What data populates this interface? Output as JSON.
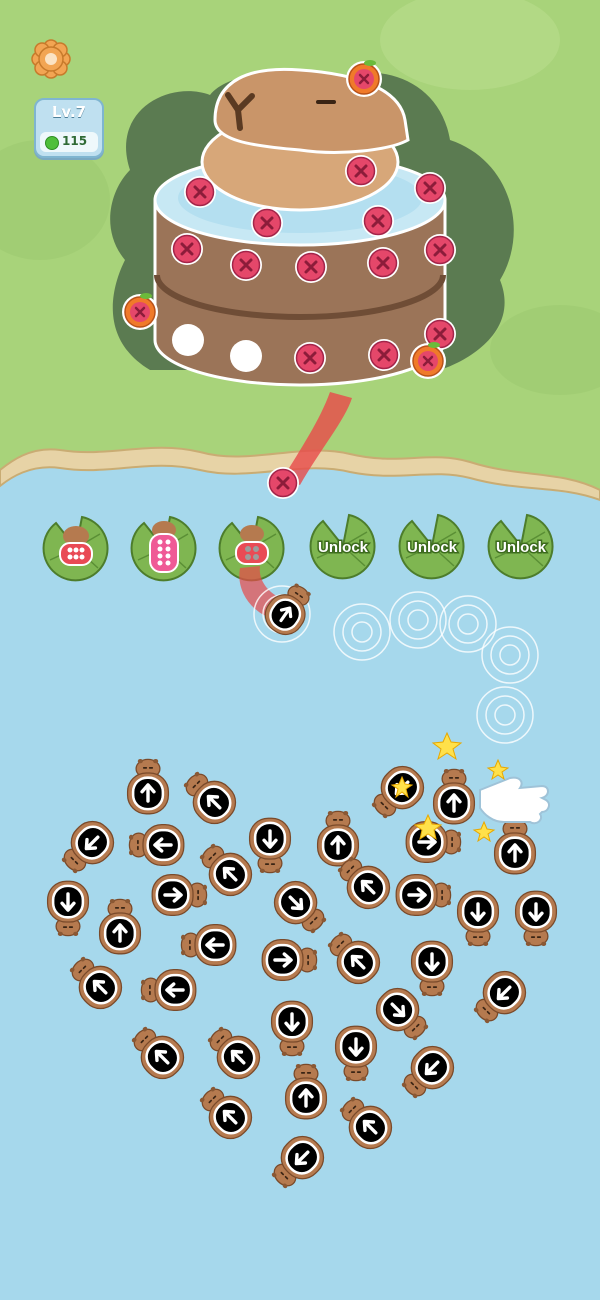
{
  "hud": {
    "settings_icon": "gear-icon",
    "level_label": "Lv.7",
    "coin_icon": "green-coin-icon",
    "coins": "115"
  },
  "cake": {
    "character": "capybara",
    "screws_remaining": 16,
    "bonus_icon": "orange-fruit-icon"
  },
  "slots": [
    {
      "state": "filled",
      "color": "red"
    },
    {
      "state": "filled",
      "color": "pink"
    },
    {
      "state": "filled",
      "color": "red"
    },
    {
      "state": "locked",
      "label": "Unlock"
    },
    {
      "state": "locked",
      "label": "Unlock"
    },
    {
      "state": "locked",
      "label": "Unlock"
    }
  ],
  "board": {
    "shape": "heart",
    "piece_icon": "capybara-arrow-piece",
    "tutorial_icon": "pointing-hand-icon"
  },
  "colors": {
    "grass": "#a8d37a",
    "water": "#a6d8ec",
    "shore": "#e7d3a6",
    "red_piece": "#e94a55",
    "pink_piece": "#ef5a96",
    "lily_pad": "#7fb651",
    "cake": "#a07a5c"
  }
}
